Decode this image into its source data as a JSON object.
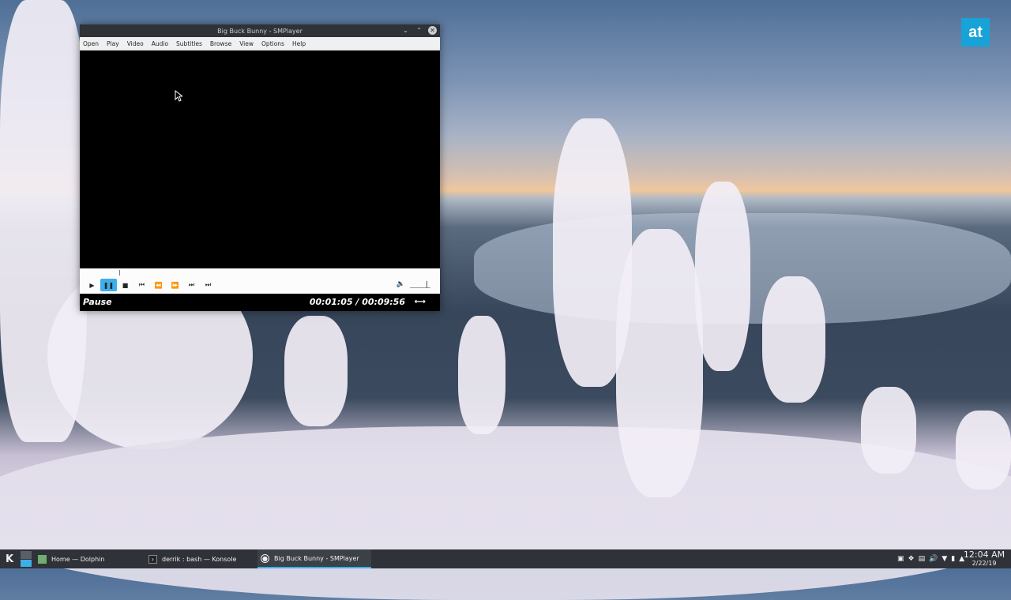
{
  "brand": {
    "label": "at"
  },
  "player": {
    "title": "Big Buck Bunny - SMPlayer",
    "menu": [
      "Open",
      "Play",
      "Video",
      "Audio",
      "Subtitles",
      "Browse",
      "View",
      "Options",
      "Help"
    ],
    "status": "Pause",
    "time": "00:01:05 / 00:09:56"
  },
  "taskbar": {
    "kmenu_glyph": "K",
    "tasks": [
      {
        "label": "Home — Dolphin",
        "icon": "folder-icon"
      },
      {
        "label": "derrik : bash — Konsole",
        "icon": "terminal-icon"
      },
      {
        "label": "Big Buck Bunny - SMPlayer",
        "icon": "smplayer-icon"
      }
    ],
    "clock_time": "12:04 AM",
    "clock_date": "2/22/19"
  },
  "colors": {
    "accent": "#3daee9",
    "brand": "#17a3d8",
    "taskbar": "#2f3238"
  }
}
